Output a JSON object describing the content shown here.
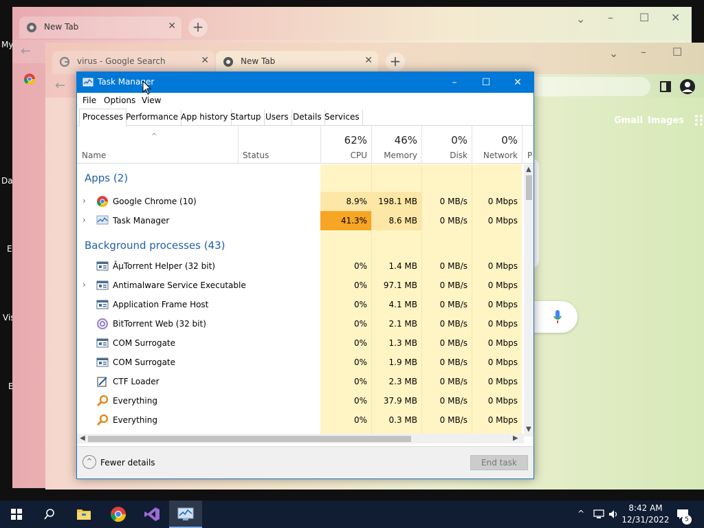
{
  "colors": {
    "accent": "#0078d7",
    "cpu_high": "#f7a524",
    "cpu_mid": "#fde7a6",
    "cpu_low": "#fff4c4",
    "group_text": "#1f5fa8",
    "taskbar": "#101d33"
  },
  "desktop": {
    "labels": [
      "My",
      "Da",
      "E",
      "Vis",
      "E"
    ]
  },
  "chrome_back": {
    "tab_title": "New Tab"
  },
  "chrome_front": {
    "tabs": [
      {
        "title": "virus - Google Search",
        "icon": "google-g-icon"
      },
      {
        "title": "New Tab",
        "icon": "chrome-icon"
      }
    ],
    "links": {
      "gmail": "Gmail",
      "images": "Images"
    }
  },
  "task_manager": {
    "title": "Task Manager",
    "menu": [
      "File",
      "Options",
      "View"
    ],
    "tabs": [
      "Processes",
      "Performance",
      "App history",
      "Startup",
      "Users",
      "Details",
      "Services"
    ],
    "active_tab": "Processes",
    "columns": {
      "name": "Name",
      "status": "Status",
      "cpu": {
        "pct": "62%",
        "label": "CPU"
      },
      "memory": {
        "pct": "46%",
        "label": "Memory"
      },
      "disk": {
        "pct": "0%",
        "label": "Disk"
      },
      "network": {
        "pct": "0%",
        "label": "Network"
      },
      "power": "P"
    },
    "groups": {
      "apps": "Apps (2)",
      "background": "Background processes (43)"
    },
    "apps": [
      {
        "name": "Google Chrome (10)",
        "cpu": "8.9%",
        "memory": "198.1 MB",
        "disk": "0 MB/s",
        "network": "0 Mbps",
        "icon": "chrome-icon",
        "expandable": true,
        "expander": "›"
      },
      {
        "name": "Task Manager",
        "cpu": "41.3%",
        "memory": "8.6 MB",
        "disk": "0 MB/s",
        "network": "0 Mbps",
        "icon": "task-manager-icon",
        "expandable": true,
        "expander": "›"
      }
    ],
    "background": [
      {
        "name": "ÂµTorrent Helper (32 bit)",
        "cpu": "0%",
        "memory": "1.4 MB",
        "disk": "0 MB/s",
        "network": "0 Mbps",
        "icon": "window-app-icon",
        "expandable": false
      },
      {
        "name": "Antimalware Service Executable",
        "cpu": "0%",
        "memory": "97.1 MB",
        "disk": "0 MB/s",
        "network": "0 Mbps",
        "icon": "window-app-icon",
        "expandable": true,
        "expander": "›"
      },
      {
        "name": "Application Frame Host",
        "cpu": "0%",
        "memory": "4.1 MB",
        "disk": "0 MB/s",
        "network": "0 Mbps",
        "icon": "window-app-icon",
        "expandable": false
      },
      {
        "name": "BitTorrent Web (32 bit)",
        "cpu": "0%",
        "memory": "2.1 MB",
        "disk": "0 MB/s",
        "network": "0 Mbps",
        "icon": "bittorrent-icon",
        "expandable": false
      },
      {
        "name": "COM Surrogate",
        "cpu": "0%",
        "memory": "1.3 MB",
        "disk": "0 MB/s",
        "network": "0 Mbps",
        "icon": "window-app-icon",
        "expandable": false
      },
      {
        "name": "COM Surrogate",
        "cpu": "0%",
        "memory": "1.9 MB",
        "disk": "0 MB/s",
        "network": "0 Mbps",
        "icon": "window-app-icon",
        "expandable": false
      },
      {
        "name": "CTF Loader",
        "cpu": "0%",
        "memory": "2.3 MB",
        "disk": "0 MB/s",
        "network": "0 Mbps",
        "icon": "ctf-loader-icon",
        "expandable": false
      },
      {
        "name": "Everything",
        "cpu": "0%",
        "memory": "37.9 MB",
        "disk": "0 MB/s",
        "network": "0 Mbps",
        "icon": "everything-search-icon",
        "expandable": false
      },
      {
        "name": "Everything",
        "cpu": "0%",
        "memory": "0.3 MB",
        "disk": "0 MB/s",
        "network": "0 Mbps",
        "icon": "everything-search-icon",
        "expandable": false
      }
    ],
    "footer": {
      "fewer_details": "Fewer details",
      "end_task": "End task"
    }
  },
  "taskbar": {
    "pinned": [
      "start-icon",
      "search-icon",
      "file-explorer-icon",
      "chrome-icon",
      "visual-studio-icon",
      "task-manager-icon"
    ],
    "clock": {
      "time": "8:42 AM",
      "date": "12/31/2022"
    },
    "notification_count": "5"
  }
}
